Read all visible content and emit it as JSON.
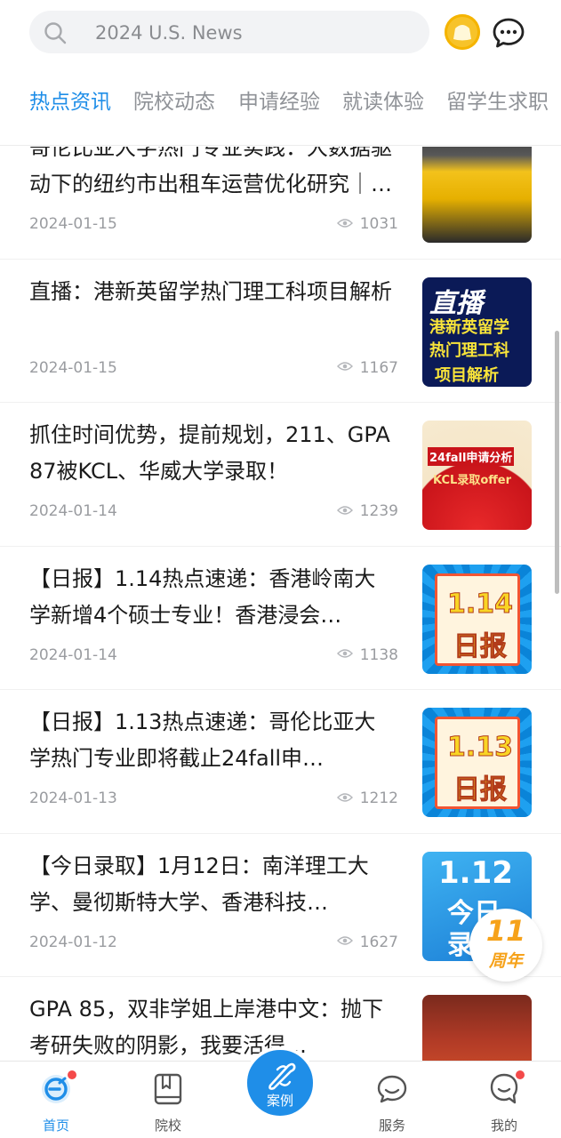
{
  "search": {
    "placeholder": "2024 U.S. News"
  },
  "icons": {
    "search": "search-icon",
    "coin": "coin-bag-icon",
    "message": "chat-bubble-icon"
  },
  "tabs": [
    {
      "label": "热点资讯",
      "active": true
    },
    {
      "label": "院校动态",
      "active": false
    },
    {
      "label": "申请经验",
      "active": false
    },
    {
      "label": "就读体验",
      "active": false
    },
    {
      "label": "留学生求职",
      "active": false
    }
  ],
  "articles": [
    {
      "title": "哥伦比亚大学热门专业实践：大数据驱动下的纽约市出租车运营优化研究｜收获…",
      "date": "2024-01-15",
      "views": "1031",
      "thumb": "taxi"
    },
    {
      "title": "直播：港新英留学热门理工科项目解析",
      "date": "2024-01-15",
      "views": "1167",
      "thumb": "live",
      "thumb_text": {
        "big": "直播",
        "l1": "港新英留学",
        "l2": "热门理工科",
        "l3": "项目解析"
      }
    },
    {
      "title": "抓住时间优势，提前规划，211、GPA 87被KCL、华威大学录取！",
      "date": "2024-01-14",
      "views": "1239",
      "thumb": "red",
      "thumb_text": {
        "t1": "24fall申请分析",
        "t2": "KCL录取offer"
      }
    },
    {
      "title": "【日报】1.14热点速递：香港岭南大学新增4个硕士专业！香港浸会…",
      "date": "2024-01-14",
      "views": "1138",
      "thumb": "daily",
      "thumb_text": {
        "n": "1.14",
        "d": "日报"
      }
    },
    {
      "title": "【日报】1.13热点速递：哥伦比亚大学热门专业即将截止24fall申…",
      "date": "2024-01-13",
      "views": "1212",
      "thumb": "daily",
      "thumb_text": {
        "n": "1.13",
        "d": "日报"
      }
    },
    {
      "title": "【今日录取】1月12日：南洋理工大学、曼彻斯特大学、香港科技…",
      "date": "2024-01-12",
      "views": "1627",
      "thumb": "sky",
      "thumb_text": {
        "n": "1.12",
        "d1": "今日",
        "d2": "录"
      }
    },
    {
      "title": "GPA 85，双非学姐上岸港中文：抛下考研失败的阴影，我要活得…",
      "date": "",
      "views": "",
      "thumb": "shop"
    }
  ],
  "anniversary_badge": {
    "number": "11",
    "text": "周年"
  },
  "bottom_nav": [
    {
      "label": "首页",
      "active": true,
      "dot": true,
      "icon": "home-icon"
    },
    {
      "label": "院校",
      "active": false,
      "dot": false,
      "icon": "book-icon"
    },
    {
      "label": "案例",
      "active": false,
      "dot": false,
      "icon": "scroll-icon"
    },
    {
      "label": "服务",
      "active": false,
      "dot": false,
      "icon": "service-chat-icon"
    },
    {
      "label": "我的",
      "active": false,
      "dot": true,
      "icon": "profile-icon"
    }
  ],
  "colors": {
    "accent": "#1f8ee8",
    "notification": "#f44a4a"
  }
}
